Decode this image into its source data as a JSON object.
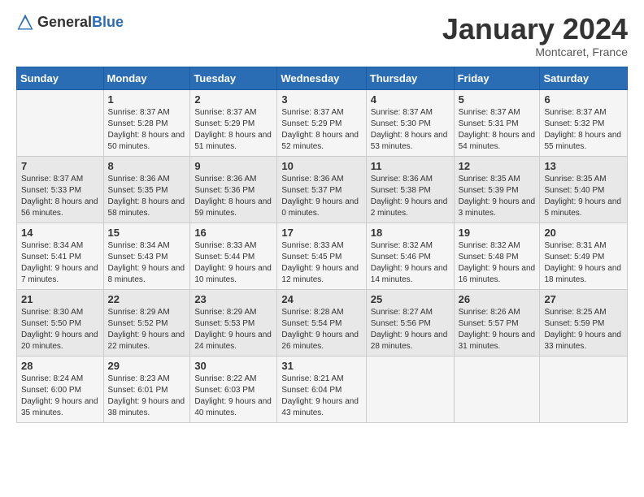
{
  "header": {
    "logo_general": "General",
    "logo_blue": "Blue",
    "month_title": "January 2024",
    "subtitle": "Montcaret, France"
  },
  "days_of_week": [
    "Sunday",
    "Monday",
    "Tuesday",
    "Wednesday",
    "Thursday",
    "Friday",
    "Saturday"
  ],
  "weeks": [
    [
      {
        "day": "",
        "sunrise": "",
        "sunset": "",
        "daylight": ""
      },
      {
        "day": "1",
        "sunrise": "Sunrise: 8:37 AM",
        "sunset": "Sunset: 5:28 PM",
        "daylight": "Daylight: 8 hours and 50 minutes."
      },
      {
        "day": "2",
        "sunrise": "Sunrise: 8:37 AM",
        "sunset": "Sunset: 5:29 PM",
        "daylight": "Daylight: 8 hours and 51 minutes."
      },
      {
        "day": "3",
        "sunrise": "Sunrise: 8:37 AM",
        "sunset": "Sunset: 5:29 PM",
        "daylight": "Daylight: 8 hours and 52 minutes."
      },
      {
        "day": "4",
        "sunrise": "Sunrise: 8:37 AM",
        "sunset": "Sunset: 5:30 PM",
        "daylight": "Daylight: 8 hours and 53 minutes."
      },
      {
        "day": "5",
        "sunrise": "Sunrise: 8:37 AM",
        "sunset": "Sunset: 5:31 PM",
        "daylight": "Daylight: 8 hours and 54 minutes."
      },
      {
        "day": "6",
        "sunrise": "Sunrise: 8:37 AM",
        "sunset": "Sunset: 5:32 PM",
        "daylight": "Daylight: 8 hours and 55 minutes."
      }
    ],
    [
      {
        "day": "7",
        "sunrise": "Sunrise: 8:37 AM",
        "sunset": "Sunset: 5:33 PM",
        "daylight": "Daylight: 8 hours and 56 minutes."
      },
      {
        "day": "8",
        "sunrise": "Sunrise: 8:36 AM",
        "sunset": "Sunset: 5:35 PM",
        "daylight": "Daylight: 8 hours and 58 minutes."
      },
      {
        "day": "9",
        "sunrise": "Sunrise: 8:36 AM",
        "sunset": "Sunset: 5:36 PM",
        "daylight": "Daylight: 8 hours and 59 minutes."
      },
      {
        "day": "10",
        "sunrise": "Sunrise: 8:36 AM",
        "sunset": "Sunset: 5:37 PM",
        "daylight": "Daylight: 9 hours and 0 minutes."
      },
      {
        "day": "11",
        "sunrise": "Sunrise: 8:36 AM",
        "sunset": "Sunset: 5:38 PM",
        "daylight": "Daylight: 9 hours and 2 minutes."
      },
      {
        "day": "12",
        "sunrise": "Sunrise: 8:35 AM",
        "sunset": "Sunset: 5:39 PM",
        "daylight": "Daylight: 9 hours and 3 minutes."
      },
      {
        "day": "13",
        "sunrise": "Sunrise: 8:35 AM",
        "sunset": "Sunset: 5:40 PM",
        "daylight": "Daylight: 9 hours and 5 minutes."
      }
    ],
    [
      {
        "day": "14",
        "sunrise": "Sunrise: 8:34 AM",
        "sunset": "Sunset: 5:41 PM",
        "daylight": "Daylight: 9 hours and 7 minutes."
      },
      {
        "day": "15",
        "sunrise": "Sunrise: 8:34 AM",
        "sunset": "Sunset: 5:43 PM",
        "daylight": "Daylight: 9 hours and 8 minutes."
      },
      {
        "day": "16",
        "sunrise": "Sunrise: 8:33 AM",
        "sunset": "Sunset: 5:44 PM",
        "daylight": "Daylight: 9 hours and 10 minutes."
      },
      {
        "day": "17",
        "sunrise": "Sunrise: 8:33 AM",
        "sunset": "Sunset: 5:45 PM",
        "daylight": "Daylight: 9 hours and 12 minutes."
      },
      {
        "day": "18",
        "sunrise": "Sunrise: 8:32 AM",
        "sunset": "Sunset: 5:46 PM",
        "daylight": "Daylight: 9 hours and 14 minutes."
      },
      {
        "day": "19",
        "sunrise": "Sunrise: 8:32 AM",
        "sunset": "Sunset: 5:48 PM",
        "daylight": "Daylight: 9 hours and 16 minutes."
      },
      {
        "day": "20",
        "sunrise": "Sunrise: 8:31 AM",
        "sunset": "Sunset: 5:49 PM",
        "daylight": "Daylight: 9 hours and 18 minutes."
      }
    ],
    [
      {
        "day": "21",
        "sunrise": "Sunrise: 8:30 AM",
        "sunset": "Sunset: 5:50 PM",
        "daylight": "Daylight: 9 hours and 20 minutes."
      },
      {
        "day": "22",
        "sunrise": "Sunrise: 8:29 AM",
        "sunset": "Sunset: 5:52 PM",
        "daylight": "Daylight: 9 hours and 22 minutes."
      },
      {
        "day": "23",
        "sunrise": "Sunrise: 8:29 AM",
        "sunset": "Sunset: 5:53 PM",
        "daylight": "Daylight: 9 hours and 24 minutes."
      },
      {
        "day": "24",
        "sunrise": "Sunrise: 8:28 AM",
        "sunset": "Sunset: 5:54 PM",
        "daylight": "Daylight: 9 hours and 26 minutes."
      },
      {
        "day": "25",
        "sunrise": "Sunrise: 8:27 AM",
        "sunset": "Sunset: 5:56 PM",
        "daylight": "Daylight: 9 hours and 28 minutes."
      },
      {
        "day": "26",
        "sunrise": "Sunrise: 8:26 AM",
        "sunset": "Sunset: 5:57 PM",
        "daylight": "Daylight: 9 hours and 31 minutes."
      },
      {
        "day": "27",
        "sunrise": "Sunrise: 8:25 AM",
        "sunset": "Sunset: 5:59 PM",
        "daylight": "Daylight: 9 hours and 33 minutes."
      }
    ],
    [
      {
        "day": "28",
        "sunrise": "Sunrise: 8:24 AM",
        "sunset": "Sunset: 6:00 PM",
        "daylight": "Daylight: 9 hours and 35 minutes."
      },
      {
        "day": "29",
        "sunrise": "Sunrise: 8:23 AM",
        "sunset": "Sunset: 6:01 PM",
        "daylight": "Daylight: 9 hours and 38 minutes."
      },
      {
        "day": "30",
        "sunrise": "Sunrise: 8:22 AM",
        "sunset": "Sunset: 6:03 PM",
        "daylight": "Daylight: 9 hours and 40 minutes."
      },
      {
        "day": "31",
        "sunrise": "Sunrise: 8:21 AM",
        "sunset": "Sunset: 6:04 PM",
        "daylight": "Daylight: 9 hours and 43 minutes."
      },
      {
        "day": "",
        "sunrise": "",
        "sunset": "",
        "daylight": ""
      },
      {
        "day": "",
        "sunrise": "",
        "sunset": "",
        "daylight": ""
      },
      {
        "day": "",
        "sunrise": "",
        "sunset": "",
        "daylight": ""
      }
    ]
  ]
}
